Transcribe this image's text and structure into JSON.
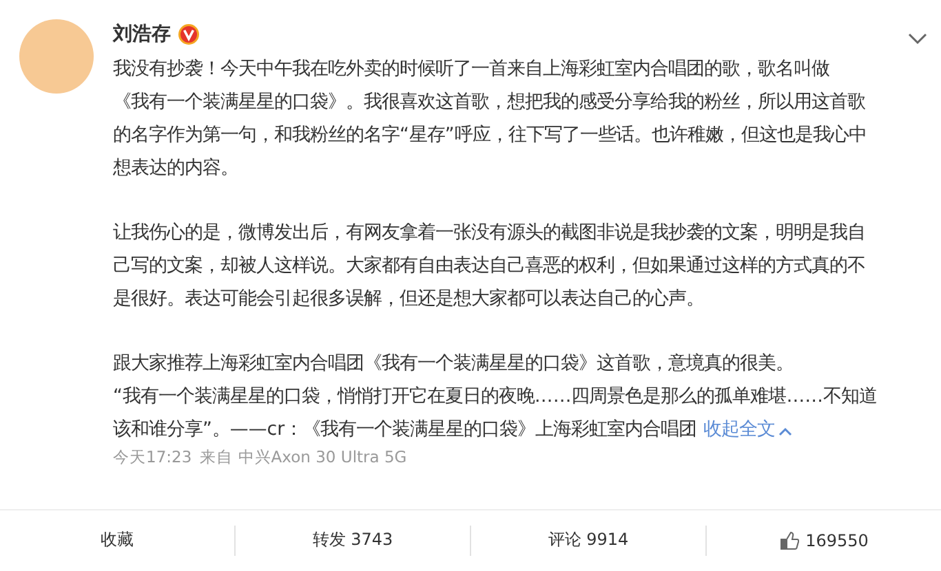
{
  "post": {
    "author": "刘浩存",
    "verified": true,
    "paragraphs": [
      {
        "lines": [
          "我没有抄袭！今天中午我在吃外卖的时候听了一首来自上海彩虹室内合唱团的歌，歌名叫做",
          "《我有一个装满星星的口袋》。我很喜欢这首歌，想把我的感受分享给我的粉丝，所以用这首歌",
          "的名字作为第一句，和我粉丝的名字“星存”呼应，往下写了一些话。也许稚嫩，但这也是我心中",
          "想表达的内容。"
        ]
      },
      {
        "lines": [
          "让我伤心的是，微博发出后，有网友拿着一张没有源头的截图非说是我抄袭的文案，明明是我自",
          "己写的文案，却被人这样说。大家都有自由表达自己喜恶的权利，但如果通过这样的方式真的不",
          "是很好。表达可能会引起很多误解，但还是想大家都可以表达自己的心声。"
        ]
      },
      {
        "lines": [
          "跟大家推荐上海彩虹室内合唱团《我有一个装满星星的口袋》这首歌，意境真的很美。",
          "“我有一个装满星星的口袋，悄悄打开它在夏日的夜晚……四周景色是那么的孤单难堪……不知道",
          "该和谁分享”。——cr：《我有一个装满星星的口袋》上海彩虹室内合唱团"
        ]
      }
    ],
    "collapse_link": "收起全文",
    "time": "今天17:23",
    "source": "来自 中兴Axon 30 Ultra 5G"
  },
  "actions": [
    {
      "kind": "favorite",
      "label": "收藏"
    },
    {
      "kind": "repost",
      "label": "转发 3743"
    },
    {
      "kind": "comment",
      "label": "评论 9914"
    },
    {
      "kind": "like",
      "label": "169550"
    }
  ]
}
